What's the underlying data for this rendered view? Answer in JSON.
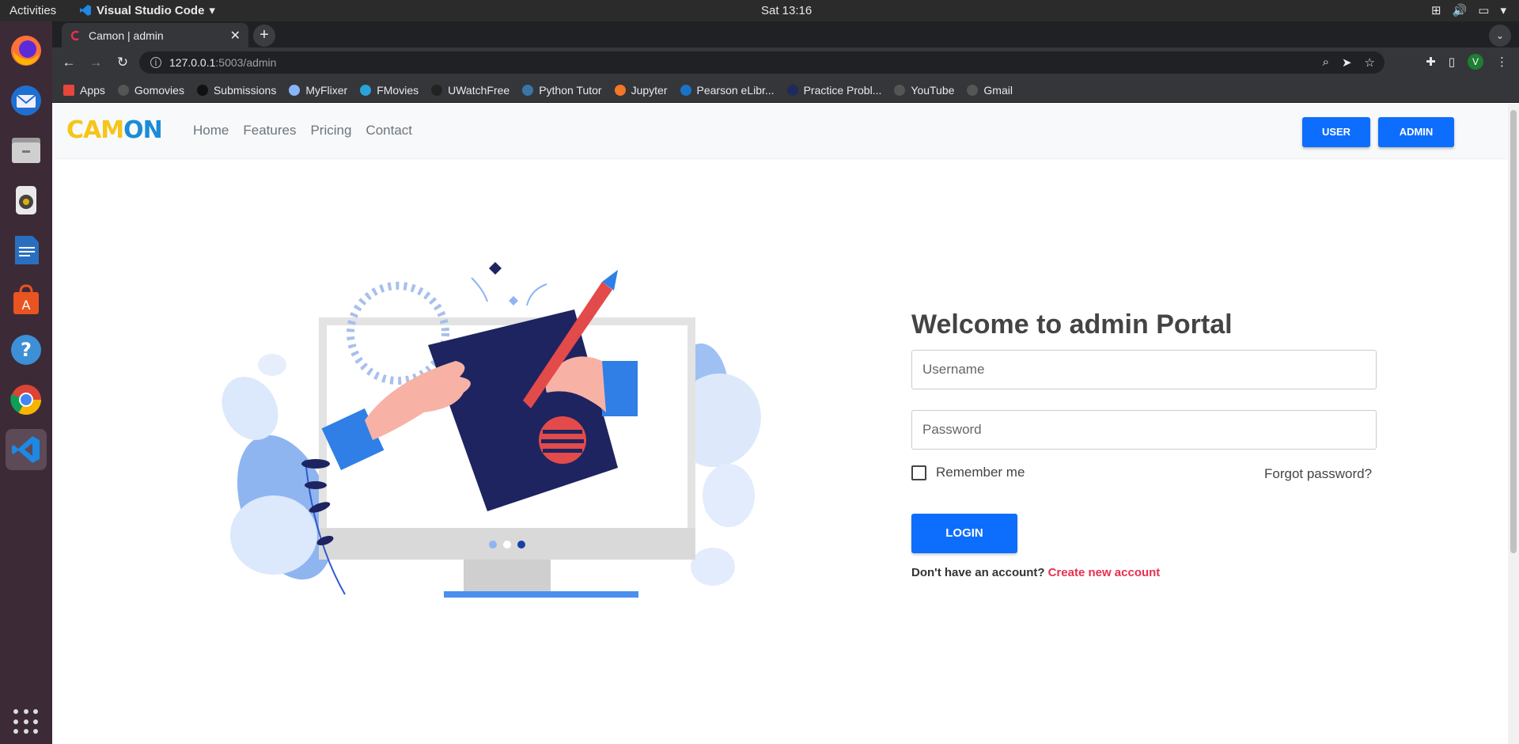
{
  "os": {
    "activities": "Activities",
    "app_name": "Visual Studio Code",
    "clock": "Sat 13:16"
  },
  "dock": {
    "items": [
      "firefox-icon",
      "thunderbird-icon",
      "files-icon",
      "rhythmbox-icon",
      "writer-icon",
      "software-icon",
      "help-icon",
      "chrome-icon",
      "vscode-icon"
    ]
  },
  "browser": {
    "tab_title": "Camon | admin",
    "url_host": "127.0.0.1",
    "url_path": ":5003/admin",
    "profile_initial": "V",
    "bookmarks": [
      {
        "label": "Apps",
        "color": "#e8453c"
      },
      {
        "label": "Gomovies",
        "color": "#555555"
      },
      {
        "label": "Submissions",
        "color": "#111111"
      },
      {
        "label": "MyFlixer",
        "color": "#8ab4f8"
      },
      {
        "label": "FMovies",
        "color": "#2aa3d8"
      },
      {
        "label": "UWatchFree",
        "color": "#222222"
      },
      {
        "label": "Python Tutor",
        "color": "#3a75a8"
      },
      {
        "label": "Jupyter",
        "color": "#f37726"
      },
      {
        "label": "Pearson eLibr...",
        "color": "#1a73c8"
      },
      {
        "label": "Practice Probl...",
        "color": "#1e2a5a"
      },
      {
        "label": "YouTube",
        "color": "#555555"
      },
      {
        "label": "Gmail",
        "color": "#555555"
      }
    ]
  },
  "site": {
    "logo": {
      "part1": "CAM",
      "part2": "ON"
    },
    "nav": [
      "Home",
      "Features",
      "Pricing",
      "Contact"
    ],
    "user_button": "USER",
    "admin_button": "ADMIN",
    "accent": "#0d6efd"
  },
  "login": {
    "heading": "Welcome to admin Portal",
    "username_placeholder": "Username",
    "password_placeholder": "Password",
    "remember_label": "Remember me",
    "forgot_label": "Forgot password?",
    "login_button": "LOGIN",
    "signup_prompt": "Don't have an account?",
    "signup_link": "Create new account",
    "link_color": "#e8304f"
  }
}
